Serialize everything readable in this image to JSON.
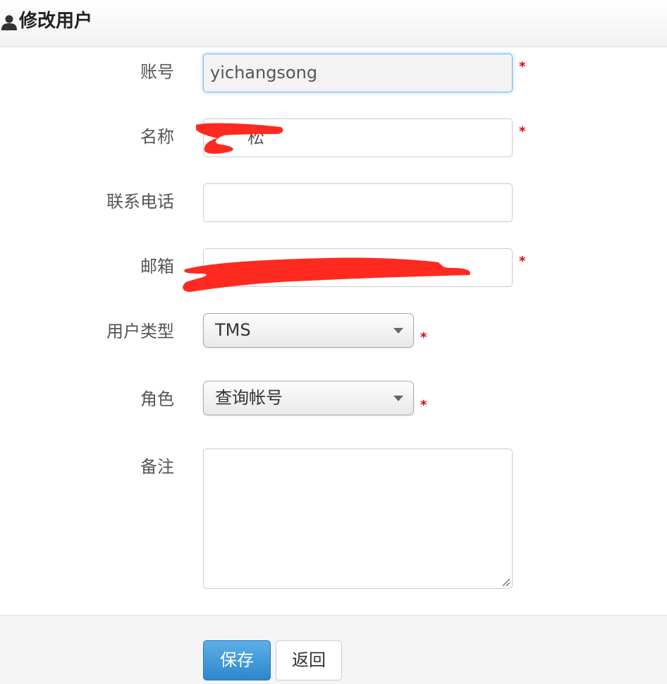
{
  "header": {
    "title": "修改用户",
    "icon": "user-icon"
  },
  "form": {
    "account": {
      "label": "账号",
      "value": "yichangsong",
      "required_mark": "*"
    },
    "name": {
      "label": "名称",
      "value": "松",
      "required_mark": "*"
    },
    "phone": {
      "label": "联系电话",
      "value": ""
    },
    "email": {
      "label": "邮箱",
      "value": "",
      "required_mark": "*"
    },
    "user_type": {
      "label": "用户类型",
      "value": "TMS",
      "required_mark": "*"
    },
    "role": {
      "label": "角色",
      "value": "查询帐号",
      "required_mark": "*"
    },
    "remark": {
      "label": "备注",
      "value": ""
    }
  },
  "actions": {
    "save_label": "保存",
    "back_label": "返回"
  },
  "colors": {
    "primary_button": "#2e86cc",
    "required": "#e00000",
    "focus_border": "#7eb4e6",
    "redaction": "#ff2a1f"
  }
}
